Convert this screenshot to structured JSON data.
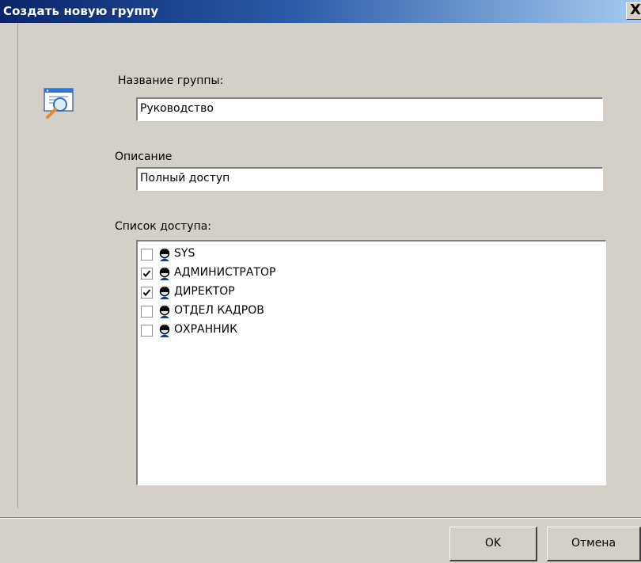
{
  "window": {
    "title": "Создать новую группу",
    "close_glyph": "X"
  },
  "form": {
    "group_name_label": "Название группы:",
    "group_name_value": "Руководство",
    "description_label": "Описание",
    "description_value": "Полный доступ",
    "access_list_label": "Список доступа:"
  },
  "access_list": [
    {
      "label": "SYS",
      "checked": false,
      "icon": "user-icon"
    },
    {
      "label": "АДМИНИСТРАТОР",
      "checked": true,
      "icon": "user-icon"
    },
    {
      "label": "ДИРЕКТОР",
      "checked": true,
      "icon": "user-icon"
    },
    {
      "label": "ОТДЕЛ КАДРОВ",
      "checked": false,
      "icon": "user-icon"
    },
    {
      "label": "ОХРАННИК",
      "checked": false,
      "icon": "user-icon"
    }
  ],
  "buttons": {
    "ok_label": "OK",
    "cancel_label": "Отмена"
  },
  "colors": {
    "titlebar_start": "#0a246a",
    "titlebar_end": "#a6caf0",
    "dialog_bg": "#d4d0c8"
  }
}
